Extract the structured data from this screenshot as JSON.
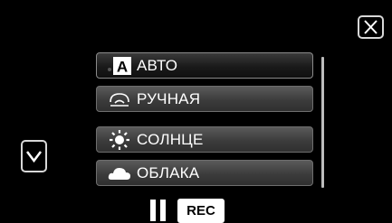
{
  "close_button": {
    "icon": "close-icon"
  },
  "scroll_down_button": {
    "icon": "chevron-down-icon"
  },
  "menu": {
    "items": [
      {
        "label": "АВТО",
        "icon": "auto-icon",
        "selected": true
      },
      {
        "label": "РУЧНАЯ",
        "icon": "manual-icon",
        "selected": false
      },
      {
        "label": "СОЛНЦЕ",
        "icon": "sun-icon",
        "selected": false
      },
      {
        "label": "ОБЛАКА",
        "icon": "cloud-icon",
        "selected": false
      }
    ]
  },
  "status": {
    "pause_icon": "pause-icon",
    "rec_label": "REC"
  }
}
